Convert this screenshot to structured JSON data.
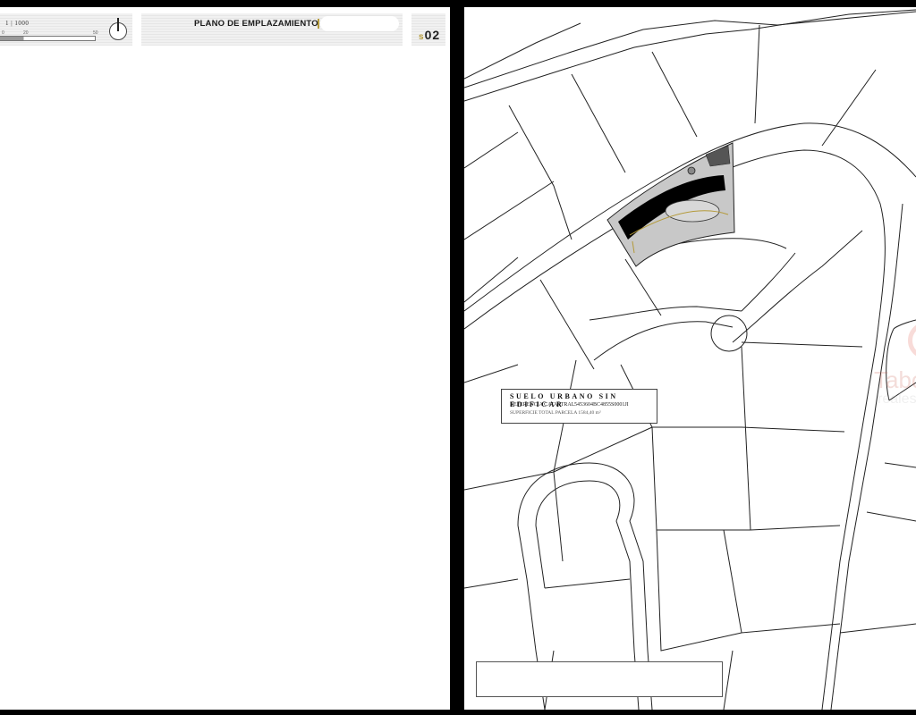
{
  "header": {
    "scale_label": "1 | 1000",
    "scale_ticks": [
      "0",
      "20",
      "50"
    ],
    "plan_title": "PLANO DE EMPLAZAMIENTO",
    "sheet_prefix": "s",
    "sheet_number": "02"
  },
  "parcel_info": {
    "title": "SUELO URBANO SIN EDIFICAR",
    "reference_label": "REFERENCIA CATASTRAL",
    "reference_value": "5453604BC4855S0001JI",
    "surface": "SUPERFICIE TOTAL PARCELA 1584,40 m²"
  },
  "watermark": {
    "brand": "Tabora",
    "sub": "realestate"
  },
  "colors": {
    "accent": "#b49a3a",
    "frame": "#000000",
    "line": "#222222"
  }
}
